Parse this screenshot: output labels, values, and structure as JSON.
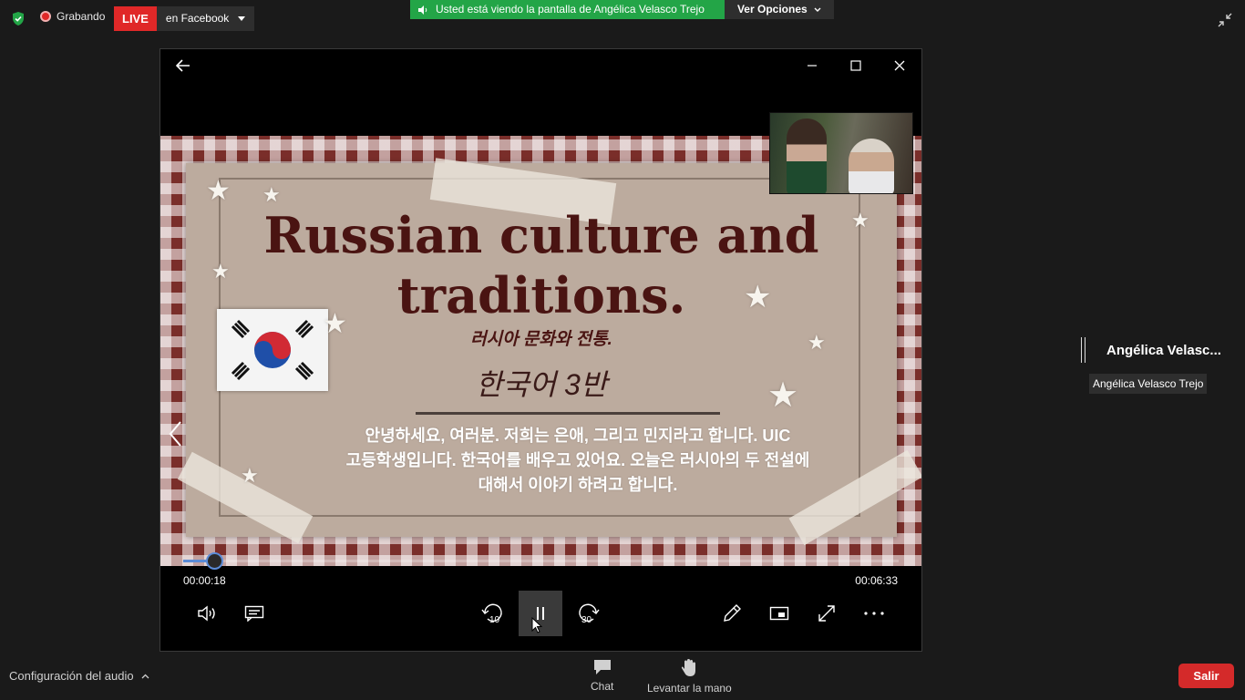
{
  "topbar": {
    "recording_label": "Grabando",
    "live_label": "LIVE",
    "live_destination": "en Facebook",
    "share_message": "Usted está viendo la pantalla de Angélica Velasco Trejo",
    "view_options": "Ver Opciones"
  },
  "slide": {
    "title_line1": "Russian culture and",
    "title_line2": "traditions.",
    "subtitle": "러시아 문화와 전통.",
    "class_label": "한국어 3반",
    "body_line1": "안녕하세요, 여러분. 저희는 은애, 그리고 민지라고 합니다. UIC",
    "body_line2": "고등학생입니다. 한국어를 배우고 있어요. 오늘은 러시아의 두 전설에",
    "body_line3": "대해서 이야기 하려고 합니다."
  },
  "player": {
    "elapsed": "00:00:18",
    "remaining": "00:06:33",
    "progress": 0.0439,
    "rewind_label": "10",
    "forward_label": "30"
  },
  "participant": {
    "tile_name": "Angélica Velasc...",
    "full_name": "Angélica Velasco Trejo"
  },
  "bottom": {
    "audio_settings": "Configuración del audio",
    "chat": "Chat",
    "raise_hand": "Levantar la mano",
    "leave": "Salir"
  },
  "colors": {
    "live_red": "#e02828",
    "share_green": "#23a547",
    "progress_blue": "#5b8bd6",
    "leave_red": "#d42a2a"
  },
  "icons": [
    "shield-icon",
    "recording-icon",
    "caret-down-icon",
    "microphone-icon",
    "chevron-down-icon",
    "exit-fullscreen-icon",
    "back-arrow-icon",
    "minimize-icon",
    "maximize-icon",
    "close-icon",
    "previous-slide-icon",
    "volume-icon",
    "subtitles-icon",
    "rewind-10-icon",
    "pause-icon",
    "forward-30-icon",
    "pen-icon",
    "mini-player-icon",
    "fullscreen-icon",
    "more-icon",
    "chevron-up-icon",
    "chat-icon",
    "hand-icon"
  ]
}
